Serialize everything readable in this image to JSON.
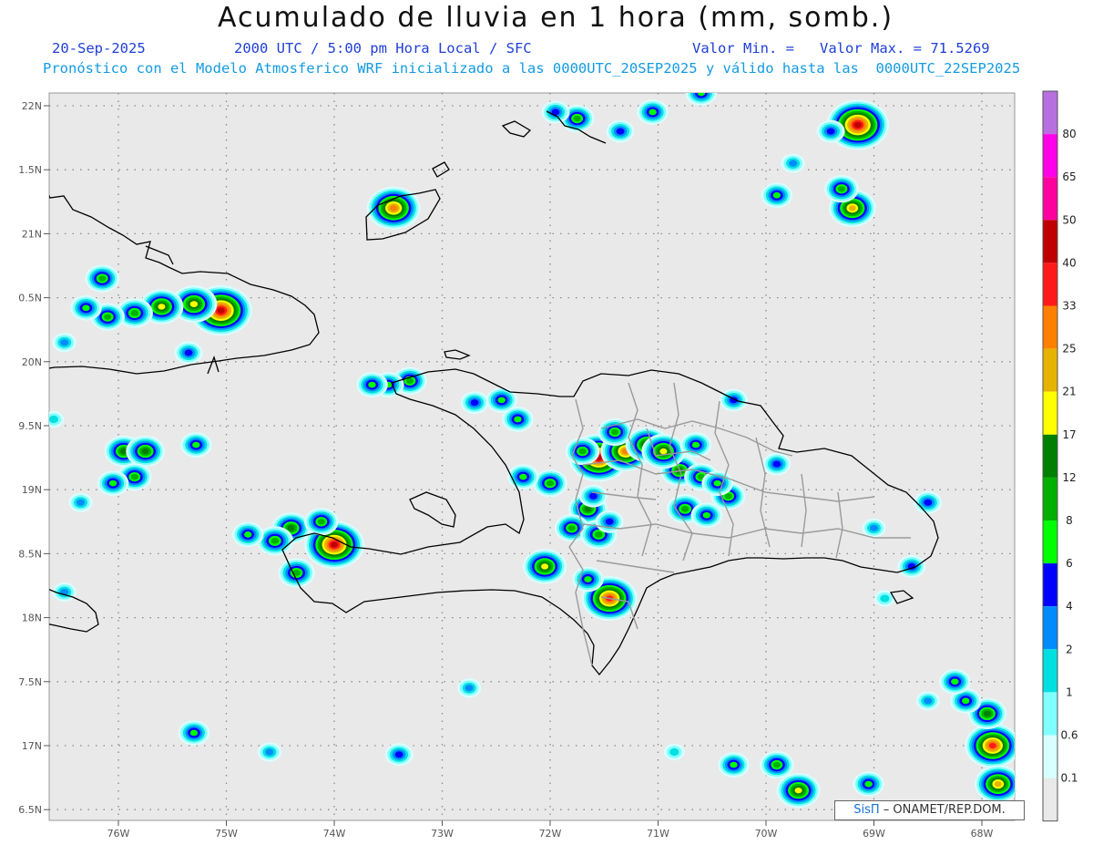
{
  "header": {
    "title": "Acumulado de lluvia en 1 hora (mm, somb.)",
    "date": "20-Sep-2025",
    "valid_time": "2000 UTC / 5:00 pm Hora Local / SFC",
    "valor_min": "Valor Min. =",
    "valor_max": "Valor Max. = 71.5269",
    "forecast_line": "Pronóstico con el Modelo Atmosferico WRF inicializado a las 0000UTC_20SEP2025 y válido hasta las  0000UTC_22SEP2025"
  },
  "axes": {
    "lat_labels": [
      "22N",
      "1.5N",
      "21N",
      "0.5N",
      "20N",
      "9.5N",
      "19N",
      "8.5N",
      "18N",
      "7.5N",
      "17N",
      "6.5N"
    ],
    "lon_labels": [
      "76W",
      "75W",
      "74W",
      "73W",
      "72W",
      "71W",
      "70W",
      "69W",
      "68W"
    ]
  },
  "colorbar": {
    "labels": [
      "80",
      "65",
      "50",
      "40",
      "33",
      "25",
      "21",
      "17",
      "12",
      "8",
      "6",
      "4",
      "2",
      "1",
      "0.6",
      "0.1"
    ],
    "colors": [
      "#b870e0",
      "#ff00e8",
      "#ff00a0",
      "#c00000",
      "#ff1a1a",
      "#ff8000",
      "#e6b400",
      "#ffff00",
      "#008000",
      "#00b000",
      "#00ff00",
      "#0000ff",
      "#008cff",
      "#00e0e0",
      "#80ffff",
      "#d8ffff",
      "#e9e9e9"
    ]
  },
  "credit": {
    "brand": "SisΠ",
    "text": "– ONAMET/REP.DOM."
  },
  "rain_cells": [
    {
      "lon": -75.05,
      "lat": 20.4,
      "v": 45
    },
    {
      "lon": -75.3,
      "lat": 20.45,
      "v": 20
    },
    {
      "lon": -75.6,
      "lat": 20.43,
      "v": 17
    },
    {
      "lon": -75.85,
      "lat": 20.38,
      "v": 10
    },
    {
      "lon": -76.1,
      "lat": 20.35,
      "v": 8
    },
    {
      "lon": -76.3,
      "lat": 20.42,
      "v": 6
    },
    {
      "lon": -76.15,
      "lat": 20.65,
      "v": 8
    },
    {
      "lon": -75.35,
      "lat": 20.07,
      "v": 4
    },
    {
      "lon": -76.5,
      "lat": 20.15,
      "v": 2
    },
    {
      "lon": -75.95,
      "lat": 19.3,
      "v": 12
    },
    {
      "lon": -75.75,
      "lat": 19.3,
      "v": 12
    },
    {
      "lon": -75.85,
      "lat": 19.1,
      "v": 8
    },
    {
      "lon": -76.05,
      "lat": 19.05,
      "v": 6
    },
    {
      "lon": -75.28,
      "lat": 19.35,
      "v": 6
    },
    {
      "lon": -76.35,
      "lat": 18.9,
      "v": 2
    },
    {
      "lon": -74.4,
      "lat": 18.7,
      "v": 12
    },
    {
      "lon": -74.55,
      "lat": 18.6,
      "v": 10
    },
    {
      "lon": -74.0,
      "lat": 18.57,
      "v": 40
    },
    {
      "lon": -74.12,
      "lat": 18.75,
      "v": 8
    },
    {
      "lon": -74.35,
      "lat": 18.35,
      "v": 10
    },
    {
      "lon": -74.8,
      "lat": 18.65,
      "v": 6
    },
    {
      "lon": -73.45,
      "lat": 21.2,
      "v": 30
    },
    {
      "lon": -71.75,
      "lat": 21.9,
      "v": 8
    },
    {
      "lon": -71.95,
      "lat": 21.95,
      "v": 4
    },
    {
      "lon": -71.05,
      "lat": 21.95,
      "v": 6
    },
    {
      "lon": -70.6,
      "lat": 22.1,
      "v": 6
    },
    {
      "lon": -71.35,
      "lat": 21.8,
      "v": 4
    },
    {
      "lon": -69.15,
      "lat": 21.85,
      "v": 45
    },
    {
      "lon": -69.2,
      "lat": 21.2,
      "v": 21
    },
    {
      "lon": -69.3,
      "lat": 21.35,
      "v": 8
    },
    {
      "lon": -69.9,
      "lat": 21.3,
      "v": 6
    },
    {
      "lon": -69.75,
      "lat": 21.55,
      "v": 2
    },
    {
      "lon": -69.4,
      "lat": 21.8,
      "v": 4
    },
    {
      "lon": -71.55,
      "lat": 19.25,
      "v": 40
    },
    {
      "lon": -71.3,
      "lat": 19.3,
      "v": 25
    },
    {
      "lon": -71.1,
      "lat": 19.35,
      "v": 17
    },
    {
      "lon": -71.4,
      "lat": 19.45,
      "v": 8
    },
    {
      "lon": -70.8,
      "lat": 19.15,
      "v": 12
    },
    {
      "lon": -70.95,
      "lat": 19.3,
      "v": 17
    },
    {
      "lon": -70.6,
      "lat": 19.1,
      "v": 8
    },
    {
      "lon": -71.65,
      "lat": 18.85,
      "v": 12
    },
    {
      "lon": -71.8,
      "lat": 18.7,
      "v": 8
    },
    {
      "lon": -71.55,
      "lat": 18.65,
      "v": 10
    },
    {
      "lon": -71.45,
      "lat": 18.15,
      "v": 33
    },
    {
      "lon": -71.65,
      "lat": 18.3,
      "v": 6
    },
    {
      "lon": -70.75,
      "lat": 18.85,
      "v": 10
    },
    {
      "lon": -70.55,
      "lat": 18.8,
      "v": 6
    },
    {
      "lon": -70.35,
      "lat": 18.95,
      "v": 8
    },
    {
      "lon": -70.45,
      "lat": 19.05,
      "v": 6
    },
    {
      "lon": -71.7,
      "lat": 19.3,
      "v": 8
    },
    {
      "lon": -70.65,
      "lat": 19.35,
      "v": 6
    },
    {
      "lon": -72.05,
      "lat": 18.4,
      "v": 17
    },
    {
      "lon": -72.0,
      "lat": 19.05,
      "v": 8
    },
    {
      "lon": -72.25,
      "lat": 19.1,
      "v": 6
    },
    {
      "lon": -72.3,
      "lat": 19.55,
      "v": 6
    },
    {
      "lon": -72.45,
      "lat": 19.7,
      "v": 6
    },
    {
      "lon": -72.7,
      "lat": 19.68,
      "v": 4
    },
    {
      "lon": -73.3,
      "lat": 19.85,
      "v": 8
    },
    {
      "lon": -73.5,
      "lat": 19.82,
      "v": 6
    },
    {
      "lon": -73.65,
      "lat": 19.82,
      "v": 6
    },
    {
      "lon": -71.45,
      "lat": 18.75,
      "v": 4
    },
    {
      "lon": -71.6,
      "lat": 18.95,
      "v": 4
    },
    {
      "lon": -70.3,
      "lat": 19.7,
      "v": 4
    },
    {
      "lon": -69.9,
      "lat": 19.2,
      "v": 4
    },
    {
      "lon": -68.5,
      "lat": 18.9,
      "v": 4
    },
    {
      "lon": -68.65,
      "lat": 18.4,
      "v": 4
    },
    {
      "lon": -68.9,
      "lat": 18.15,
      "v": 1
    },
    {
      "lon": -69.0,
      "lat": 18.7,
      "v": 2
    },
    {
      "lon": -67.9,
      "lat": 17.0,
      "v": 33
    },
    {
      "lon": -67.95,
      "lat": 17.25,
      "v": 12
    },
    {
      "lon": -67.85,
      "lat": 16.7,
      "v": 21
    },
    {
      "lon": -68.15,
      "lat": 17.35,
      "v": 6
    },
    {
      "lon": -68.25,
      "lat": 17.5,
      "v": 6
    },
    {
      "lon": -68.5,
      "lat": 17.35,
      "v": 2
    },
    {
      "lon": -69.7,
      "lat": 16.65,
      "v": 17
    },
    {
      "lon": -69.9,
      "lat": 16.85,
      "v": 8
    },
    {
      "lon": -70.3,
      "lat": 16.85,
      "v": 6
    },
    {
      "lon": -69.05,
      "lat": 16.7,
      "v": 6
    },
    {
      "lon": -73.4,
      "lat": 16.93,
      "v": 4
    },
    {
      "lon": -75.3,
      "lat": 17.1,
      "v": 6
    },
    {
      "lon": -74.6,
      "lat": 16.95,
      "v": 2
    },
    {
      "lon": -72.75,
      "lat": 17.45,
      "v": 2
    },
    {
      "lon": -70.85,
      "lat": 16.95,
      "v": 1
    },
    {
      "lon": -76.5,
      "lat": 18.2,
      "v": 2
    },
    {
      "lon": -76.6,
      "lat": 19.55,
      "v": 1
    }
  ]
}
